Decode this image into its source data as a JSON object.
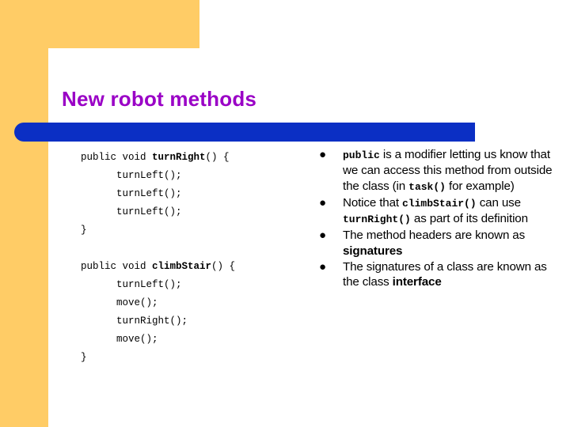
{
  "slide": {
    "title": "New robot methods",
    "colors": {
      "accent_yellow": "#FFCC66",
      "title_purple": "#9A01C6",
      "bar_blue": "#0B2FC4",
      "background": "#FFFFFF",
      "text": "#000000"
    }
  },
  "code": {
    "lines": [
      {
        "indent": false,
        "plain_before": "public void ",
        "bold": "turnRight",
        "plain_after": "() {"
      },
      {
        "indent": true,
        "plain_before": "turnLeft();",
        "bold": "",
        "plain_after": ""
      },
      {
        "indent": true,
        "plain_before": "turnLeft();",
        "bold": "",
        "plain_after": ""
      },
      {
        "indent": true,
        "plain_before": "turnLeft();",
        "bold": "",
        "plain_after": ""
      },
      {
        "indent": false,
        "plain_before": "}",
        "bold": "",
        "plain_after": ""
      },
      {
        "indent": false,
        "plain_before": "",
        "bold": "",
        "plain_after": ""
      },
      {
        "indent": false,
        "plain_before": "public void ",
        "bold": "climbStair",
        "plain_after": "() {"
      },
      {
        "indent": true,
        "plain_before": "turnLeft();",
        "bold": "",
        "plain_after": ""
      },
      {
        "indent": true,
        "plain_before": "move();",
        "bold": "",
        "plain_after": ""
      },
      {
        "indent": true,
        "plain_before": "turnRight();",
        "bold": "",
        "plain_after": ""
      },
      {
        "indent": true,
        "plain_before": "move();",
        "bold": "",
        "plain_after": ""
      },
      {
        "indent": false,
        "plain_before": "}",
        "bold": "",
        "plain_after": ""
      }
    ]
  },
  "bullets": {
    "marker": "●",
    "items": [
      {
        "parts": [
          {
            "text": "public",
            "style": "mono"
          },
          {
            "text": " is a modifier letting us know that we can access this method from outside the class (in ",
            "style": "normal"
          },
          {
            "text": "task()",
            "style": "mono"
          },
          {
            "text": " for example)",
            "style": "normal"
          }
        ]
      },
      {
        "parts": [
          {
            "text": "Notice that ",
            "style": "normal"
          },
          {
            "text": "climbStair()",
            "style": "mono"
          },
          {
            "text": " can use ",
            "style": "normal"
          },
          {
            "text": "turnRight()",
            "style": "mono"
          },
          {
            "text": " as part of its definition",
            "style": "normal"
          }
        ]
      },
      {
        "parts": [
          {
            "text": "The method headers are known as ",
            "style": "normal"
          },
          {
            "text": "signatures",
            "style": "strong"
          }
        ]
      },
      {
        "parts": [
          {
            "text": "The signatures of a class are known as the class ",
            "style": "normal"
          },
          {
            "text": "interface",
            "style": "strong"
          }
        ]
      }
    ]
  }
}
